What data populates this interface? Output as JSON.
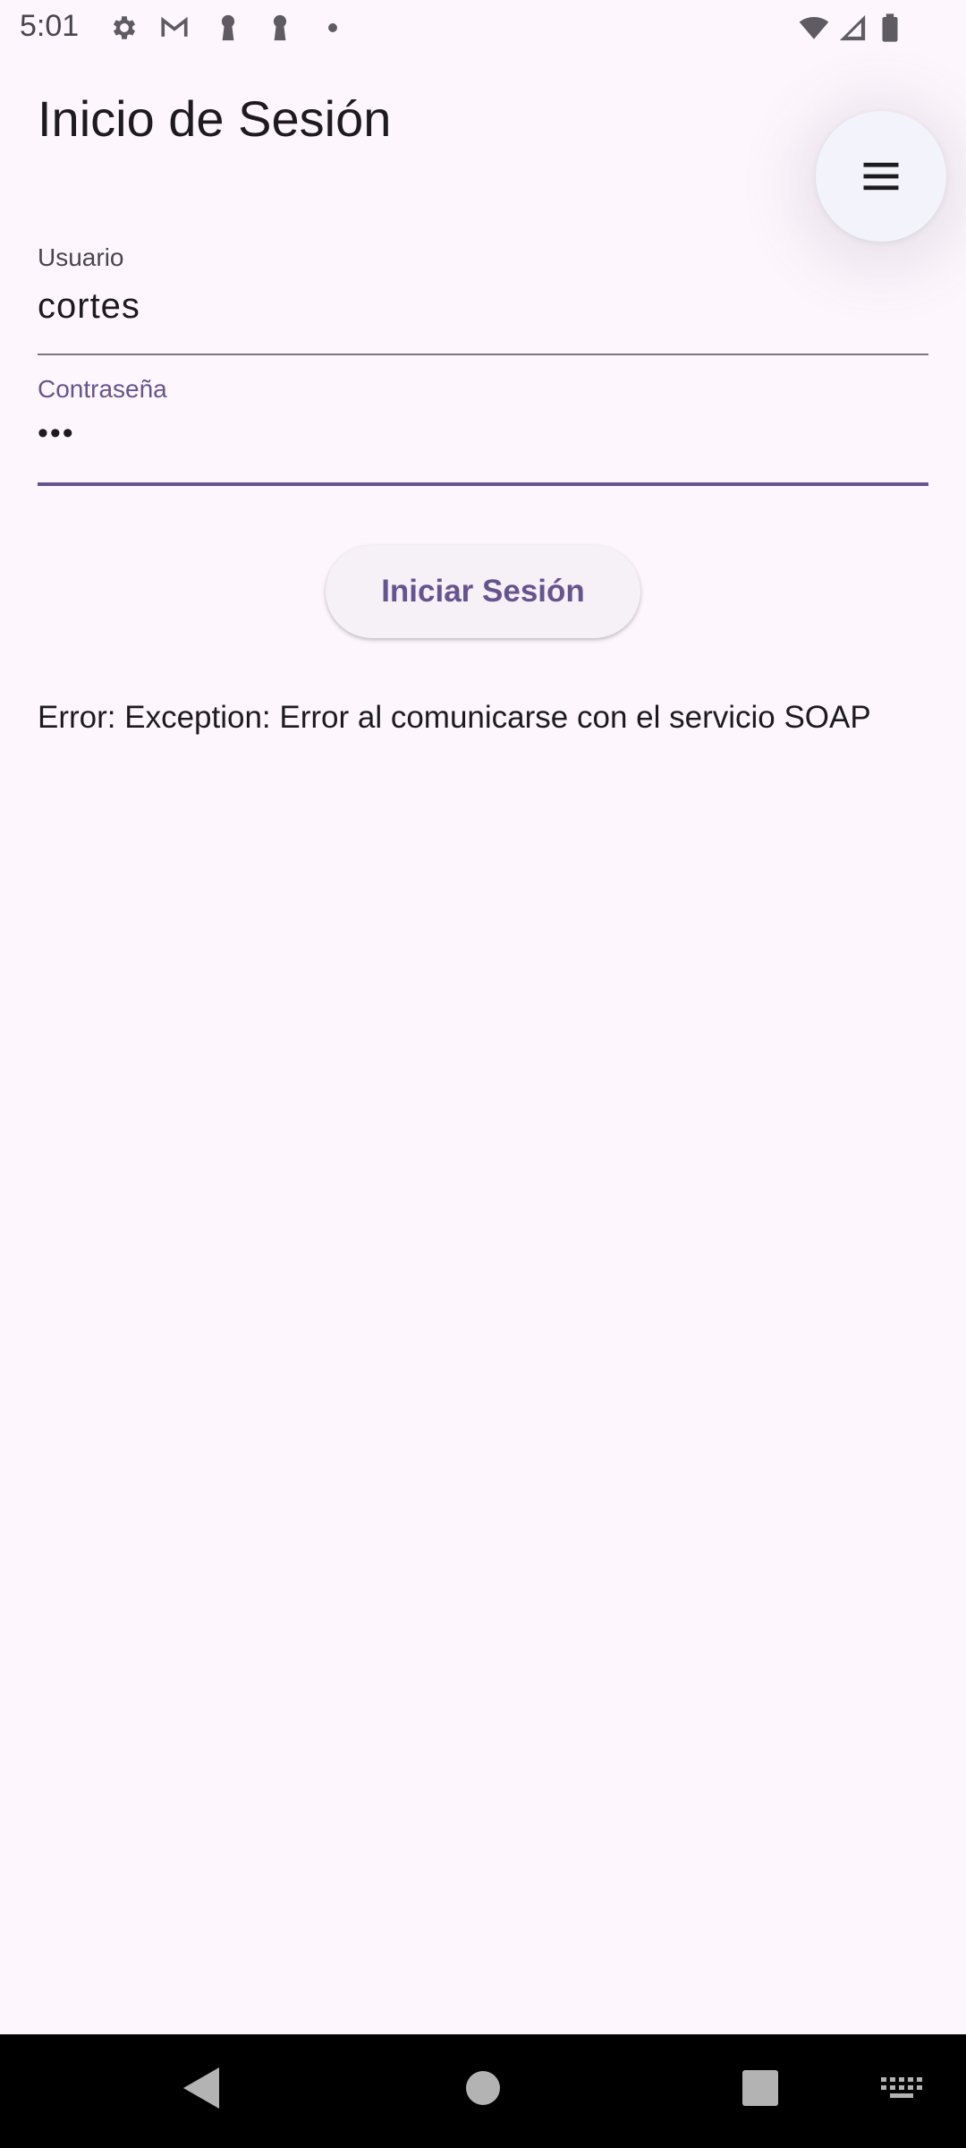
{
  "status_bar": {
    "time": "5:01",
    "left_icons": [
      "gear-icon",
      "gmail-icon",
      "keyhole-icon",
      "keyhole-icon",
      "dot-icon"
    ],
    "right_icons": [
      "wifi-icon",
      "signal-icon",
      "battery-icon"
    ]
  },
  "header": {
    "title": "Inicio de Sesión",
    "menu_icon": "hamburger-menu-icon"
  },
  "form": {
    "username": {
      "label": "Usuario",
      "value": "cortes"
    },
    "password": {
      "label": "Contraseña",
      "value": "•••"
    },
    "submit_label": "Iniciar Sesión"
  },
  "error": {
    "message": "Error: Exception: Error al comunicarse con el servicio SOAP"
  },
  "nav_bar": {
    "buttons": [
      "back-icon",
      "home-icon",
      "recents-icon",
      "keyboard-icon"
    ]
  },
  "colors": {
    "background": "#fdf7fd",
    "accent": "#65558f",
    "text": "#1d1b20",
    "nav_background": "#000000"
  }
}
